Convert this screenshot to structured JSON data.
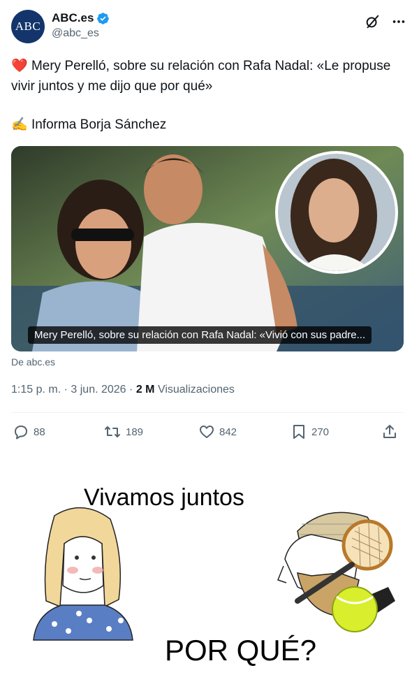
{
  "account": {
    "avatar_text": "ABC",
    "display_name": "ABC.es",
    "handle": "@abc_es",
    "verified": true,
    "brand_color": "#13356b",
    "verified_color": "#1d9bf0"
  },
  "header_icons": [
    "grok-icon",
    "more-icon"
  ],
  "tweet": {
    "emoji": "❤️",
    "text": "Mery Perelló, sobre su relación con Rafa Nadal: «Le propuse vivir juntos y me dijo que por qué»",
    "credit_emoji": "✍️",
    "credit": "Informa Borja Sánchez"
  },
  "card": {
    "caption": "Mery Perelló, sobre su relación con Rafa Nadal: «Vivió con sus padre...",
    "source": "De abc.es"
  },
  "meta": {
    "time": "1:15 p. m.",
    "separator": "·",
    "date": "3 jun. 2026",
    "views_count": "2 M",
    "views_label": "Visualizaciones"
  },
  "actions": {
    "replies": "88",
    "reposts": "189",
    "likes": "842",
    "bookmarks": "270"
  },
  "meme": {
    "top_text": "Vivamos juntos",
    "bottom_text": "POR QUÉ?"
  }
}
